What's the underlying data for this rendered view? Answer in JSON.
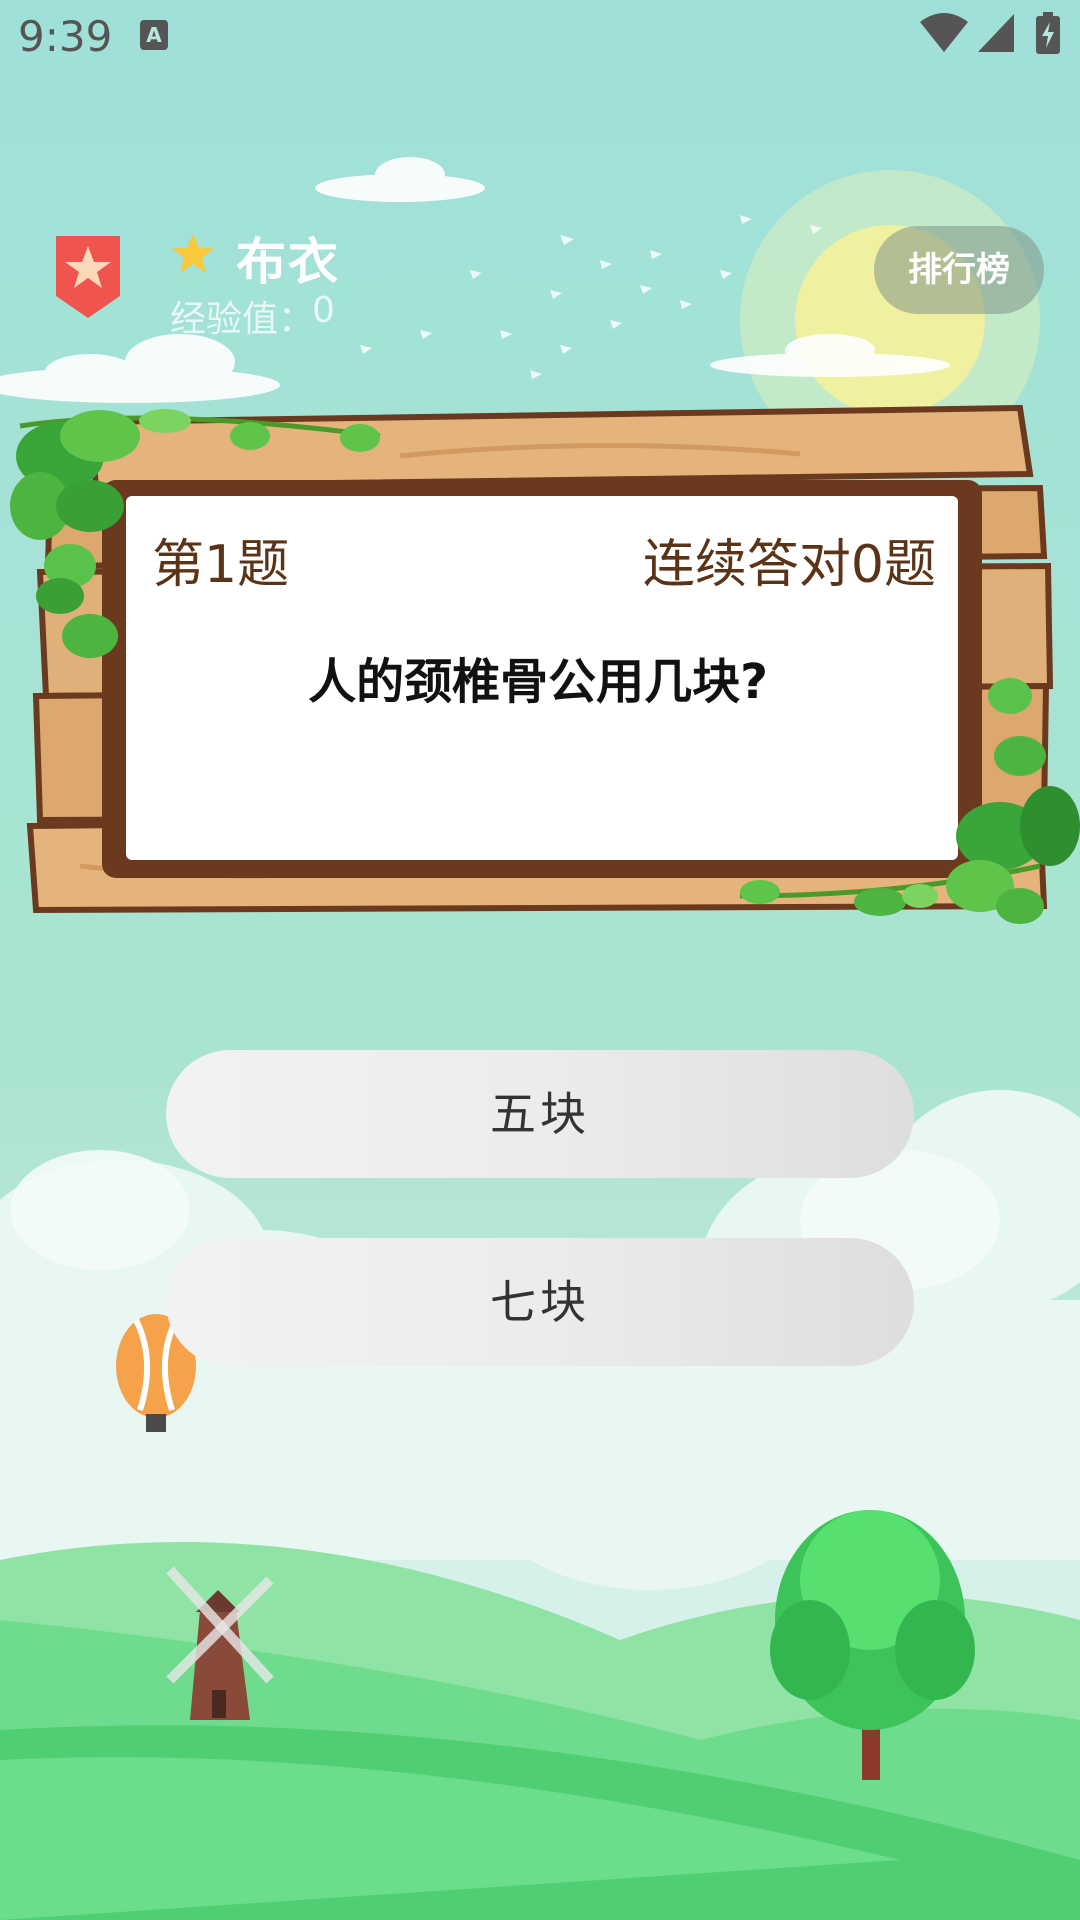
{
  "status_bar": {
    "time": "9:39",
    "icons": [
      "a-icon",
      "wifi-icon",
      "signal-icon",
      "battery-icon"
    ]
  },
  "header": {
    "user_name": "布衣",
    "exp_label": "经验值：",
    "exp_value": "0",
    "rank_button_label": "排行榜"
  },
  "question": {
    "index_label": "第1题",
    "streak_label": "连续答对0题",
    "text": "人的颈椎骨公用几块?"
  },
  "answers": [
    {
      "label": "五块"
    },
    {
      "label": "七块"
    }
  ],
  "colors": {
    "sky": "#a6e3d6",
    "board_wood": "#e0b07a",
    "board_frame": "#6b3a1e",
    "text_brown": "#5b3317",
    "badge_red": "#f0544f",
    "star_yellow": "#f9c93c"
  }
}
